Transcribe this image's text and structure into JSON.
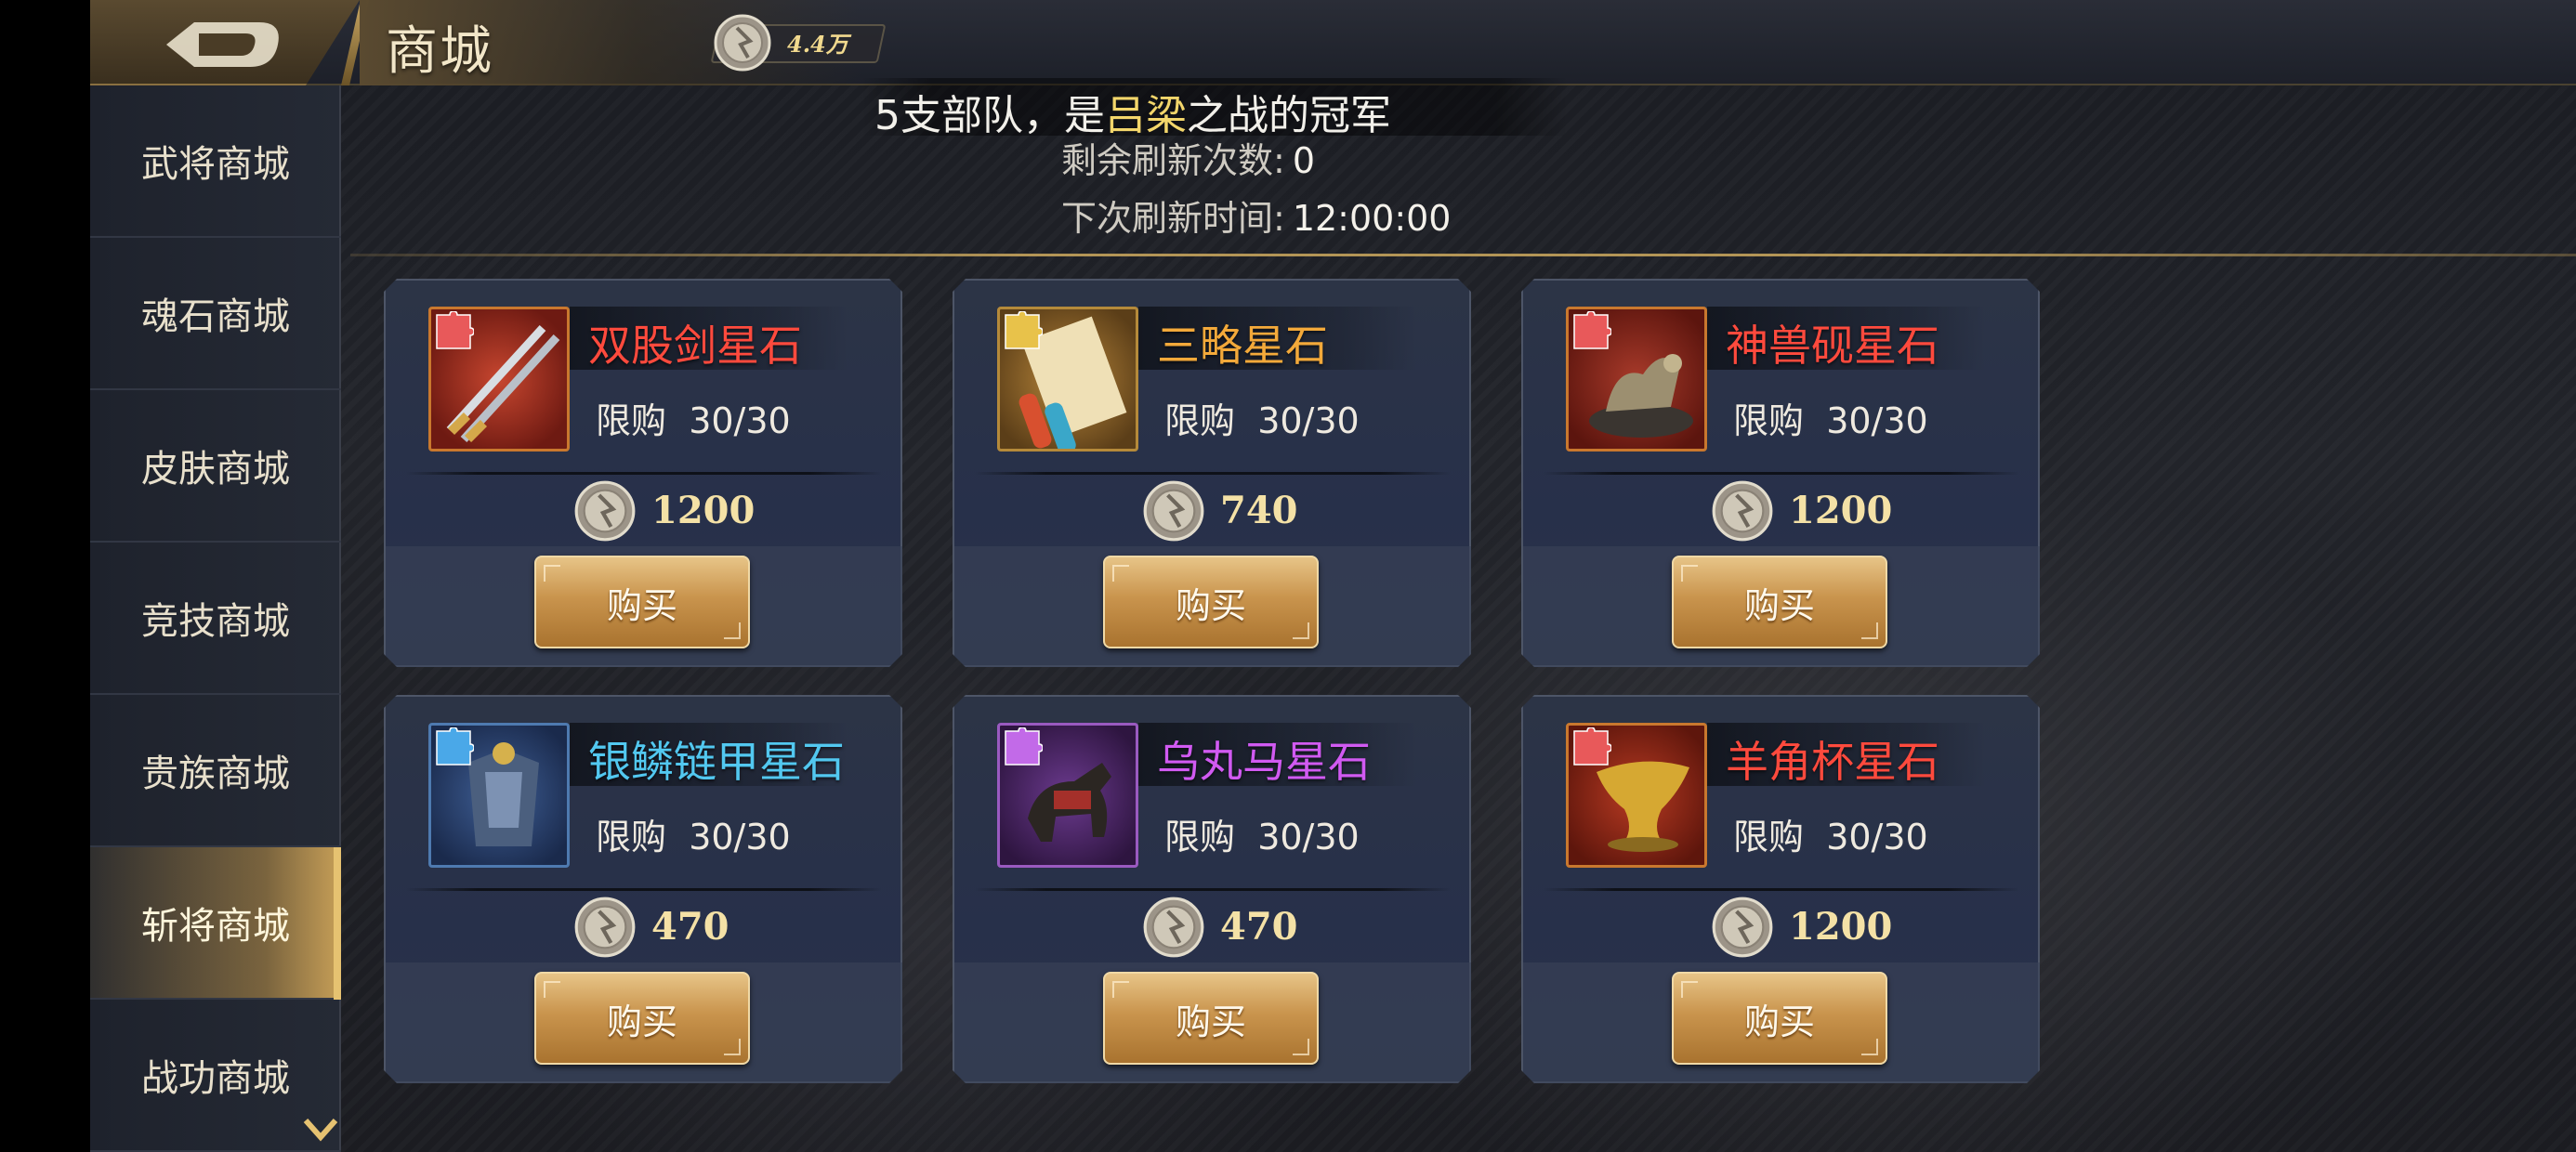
{
  "header": {
    "title": "商城",
    "currency_value": "4.4万",
    "back_icon": "back-arrow-icon",
    "currency_icon": "silver-coin-icon"
  },
  "sidebar": {
    "items": [
      {
        "label": "武将商城",
        "active": false
      },
      {
        "label": "魂石商城",
        "active": false
      },
      {
        "label": "皮肤商城",
        "active": false
      },
      {
        "label": "竞技商城",
        "active": false
      },
      {
        "label": "贵族商城",
        "active": false
      },
      {
        "label": "斩将商城",
        "active": true
      },
      {
        "label": "战功商城",
        "active": false
      }
    ]
  },
  "ticker": {
    "prefix": "5支部队，是",
    "highlight": "吕梁",
    "suffix": "之战的冠军"
  },
  "refresh": {
    "remaining_label": "剩余刷新次数:",
    "remaining_value": "0",
    "next_label": "下次刷新时间:",
    "next_value": "12:00:00"
  },
  "shop": {
    "buy_label": "购买",
    "limit_label": "限购",
    "items": [
      {
        "name": "双股剑星石",
        "name_color": "#ff4a3d",
        "limit": "30/30",
        "price": "1200",
        "icon": "twin-swords-icon"
      },
      {
        "name": "三略星石",
        "name_color": "#f3a93a",
        "limit": "30/30",
        "price": "740",
        "icon": "scroll-icon"
      },
      {
        "name": "神兽砚星石",
        "name_color": "#ff4a3d",
        "limit": "30/30",
        "price": "1200",
        "icon": "beast-inkstone-icon"
      },
      {
        "name": "银鳞链甲星石",
        "name_color": "#52c8f0",
        "limit": "30/30",
        "price": "470",
        "icon": "armor-icon"
      },
      {
        "name": "乌丸马星石",
        "name_color": "#d15af2",
        "limit": "30/30",
        "price": "470",
        "icon": "horse-icon"
      },
      {
        "name": "羊角杯星石",
        "name_color": "#ff4a3d",
        "limit": "30/30",
        "price": "1200",
        "icon": "horn-cup-icon"
      }
    ]
  },
  "colors": {
    "accent_gold": "#c9944d",
    "panel_bg": "#2a3348"
  }
}
